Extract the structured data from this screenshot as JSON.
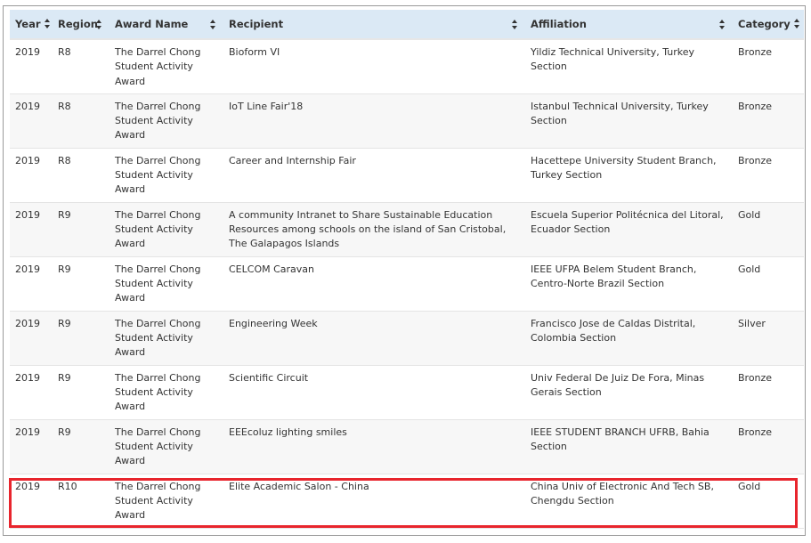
{
  "table": {
    "columns": [
      "Year",
      "Region",
      "Award Name",
      "Recipient",
      "Affiliation",
      "Category"
    ],
    "rows": [
      [
        "2019",
        "R8",
        "The Darrel Chong Student Activity Award",
        "Bioform VI",
        "Yildiz Technical University, Turkey Section",
        "Bronze"
      ],
      [
        "2019",
        "R8",
        "The Darrel Chong Student Activity Award",
        "IoT Line Fair'18",
        "Istanbul Technical University, Turkey Section",
        "Bronze"
      ],
      [
        "2019",
        "R8",
        "The Darrel Chong Student Activity Award",
        "Career and Internship Fair",
        "Hacettepe University Student Branch, Turkey Section",
        "Bronze"
      ],
      [
        "2019",
        "R9",
        "The Darrel Chong Student Activity Award",
        "A community Intranet to Share Sustainable Education Resources among schools on the island of San Cristobal, The Galapagos Islands",
        "Escuela Superior Politécnica del Litoral, Ecuador Section",
        "Gold"
      ],
      [
        "2019",
        "R9",
        "The Darrel Chong Student Activity Award",
        "CELCOM Caravan",
        "IEEE UFPA Belem Student Branch, Centro-Norte Brazil Section",
        "Gold"
      ],
      [
        "2019",
        "R9",
        "The Darrel Chong Student Activity Award",
        "Engineering Week",
        "Francisco Jose de Caldas Distrital, Colombia Section",
        "Silver"
      ],
      [
        "2019",
        "R9",
        "The Darrel Chong Student Activity Award",
        "Scientific Circuit",
        "Univ Federal De Juiz De Fora, Minas Gerais Section",
        "Bronze"
      ],
      [
        "2019",
        "R9",
        "The Darrel Chong Student Activity Award",
        "EEEcoluz lighting smiles",
        "IEEE STUDENT BRANCH UFRB, Bahia Section",
        "Bronze"
      ],
      [
        "2019",
        "R10",
        "The Darrel Chong Student Activity Award",
        "Elite Academic Salon - China",
        "China Univ of Electronic And Tech SB, Chengdu Section",
        "Gold"
      ]
    ],
    "highlighted_row": 8
  },
  "colors": {
    "header_bg": "#dbe9f5",
    "row_alt_bg": "#f7f7f7",
    "highlight_border": "#e8252d"
  },
  "icons": {
    "sort": "sort-arrows-icon"
  }
}
